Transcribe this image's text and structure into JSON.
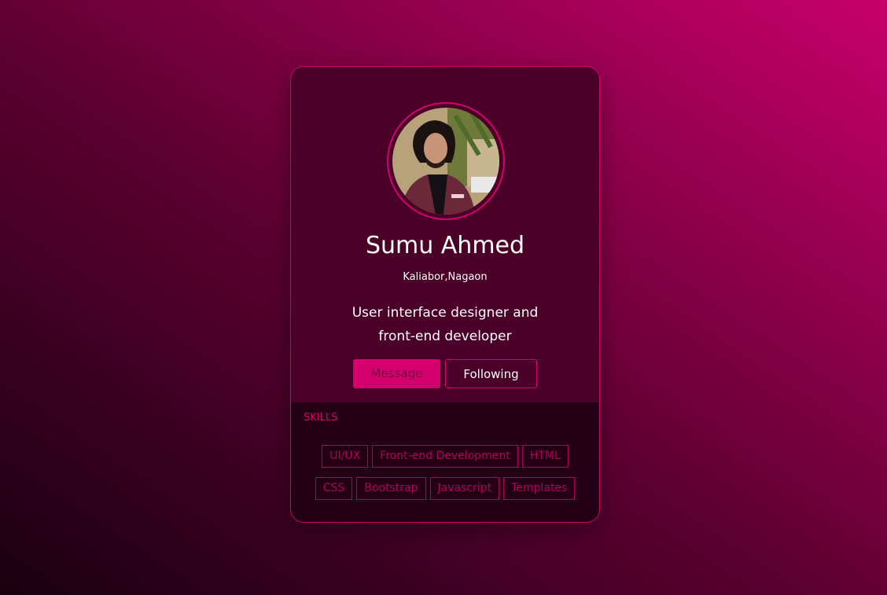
{
  "profile": {
    "name": "Sumu Ahmed",
    "location": "Kaliabor,Nagaon",
    "bio": "User interface designer and front-end developer",
    "avatar_alt": "profile photo"
  },
  "actions": {
    "message_label": "Message",
    "following_label": "Following"
  },
  "skills": {
    "title": "SKILLS",
    "items": [
      "UI/UX",
      "Front-end Development",
      "HTML",
      "CSS",
      "Bootstrap",
      "Javascript",
      "Templates"
    ]
  },
  "colors": {
    "accent": "#d4006e",
    "card_top": "#4a0027",
    "card_bottom": "#230014"
  }
}
